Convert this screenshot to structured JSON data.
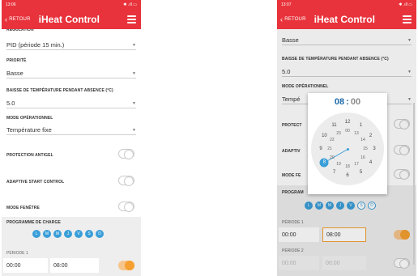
{
  "colors": {
    "brand": "#e8333c",
    "accent": "#3a9ed8",
    "toggle_on": "#f5a030"
  },
  "left": {
    "status": {
      "time": "13:06",
      "icons": "✱ .ıll ▭"
    },
    "header": {
      "back_label": "RETOUR",
      "title": "iHeat Control"
    },
    "regulation": {
      "label": "RÉGULATION",
      "value": "PID (période 15 min.)"
    },
    "priority": {
      "label": "PRIORITÉ",
      "value": "Basse"
    },
    "absence": {
      "label": "BAISSE DE TEMPÉRATURE PENDANT ABSENCE (°C)",
      "value": "5.0"
    },
    "mode": {
      "label": "MODE OPÉRATIONNEL",
      "value": "Température fixe"
    },
    "toggles": [
      {
        "label": "PROTECTION ANTIGEL",
        "on": false
      },
      {
        "label": "ADAPTIVE START CONTROL",
        "on": false
      },
      {
        "label": "MODE FENÊTRE",
        "on": false
      }
    ],
    "charge": {
      "label": "PROGRAMME DE CHARGE",
      "days": [
        "L",
        "M",
        "M",
        "J",
        "V",
        "S",
        "D"
      ],
      "days_selected": [
        true,
        true,
        true,
        true,
        true,
        true,
        true
      ],
      "period1": {
        "label": "PÉRIODE 1",
        "start": "00:00",
        "end": "08:00",
        "on": true
      }
    }
  },
  "right": {
    "status": {
      "time": "13:07",
      "icons": "✱ .ıll ▭"
    },
    "header": {
      "back_label": "RETOUR",
      "title": "iHeat Control"
    },
    "priority": {
      "value": "Basse"
    },
    "absence": {
      "label": "BAISSE DE TEMPÉRATURE PENDANT ABSENCE (°C)",
      "value": "5.0"
    },
    "mode": {
      "label": "MODE OPÉRATIONNEL",
      "value_partial": "Tempé"
    },
    "partial_labels": {
      "protection": "PROTECT",
      "adaptive": "ADAPTIV",
      "fenetre": "MODE FE",
      "programme": "PROGRAM"
    },
    "charge": {
      "days": [
        "L",
        "M",
        "M",
        "J",
        "V",
        "S",
        "D"
      ],
      "days_selected": [
        true,
        true,
        true,
        true,
        true,
        false,
        false
      ],
      "period1": {
        "label": "PÉRIODE 1",
        "start": "00:00",
        "end": "08:00",
        "on": true
      },
      "period2": {
        "label": "PÉRIODE 2",
        "start": "00:00",
        "end": "00:00",
        "on": false
      }
    },
    "time_picker": {
      "hours": "08",
      "separator": ":",
      "minutes": "00",
      "selected_hour": "8",
      "outer_numbers": [
        "12",
        "1",
        "2",
        "3",
        "4",
        "5",
        "6",
        "7",
        "8",
        "9",
        "10",
        "11"
      ],
      "inner_numbers": [
        "00",
        "13",
        "14",
        "15",
        "16",
        "17",
        "18",
        "19",
        "20",
        "21",
        "22",
        "23"
      ]
    }
  }
}
